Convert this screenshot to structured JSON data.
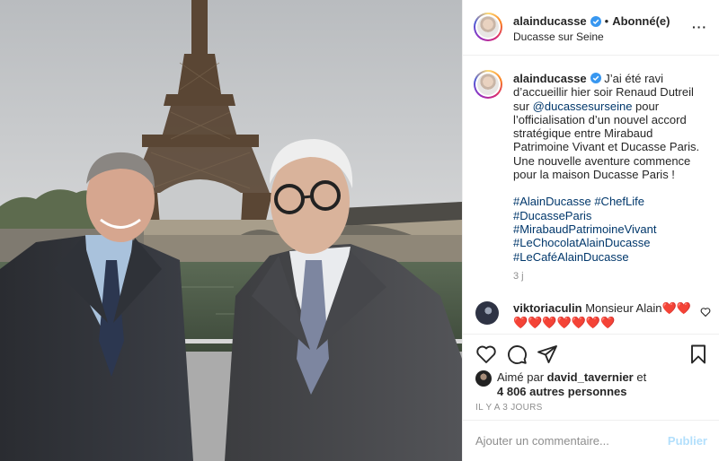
{
  "post": {
    "username": "alainducasse",
    "follow_separator": "•",
    "follow_status": "Abonné(e)",
    "location": "Ducasse sur Seine",
    "more_icon": "more-icon",
    "caption": {
      "username": "alainducasse",
      "text_before_mention": " J’ai été ravi d’accueillir hier soir Renaud Dutreil sur ",
      "mention": "@ducassesurseine",
      "text_after_mention": " pour l’officialisation d’un nouvel accord stratégique entre Mirabaud Patrimoine Vivant et Ducasse Paris. Une nouvelle aventure commence pour la maison Ducasse Paris !",
      "hashtags": [
        "#AlainDucasse #ChefLife",
        "#DucasseParis",
        "#MirabaudPatrimoineVivant",
        "#LeChocolatAlainDucasse",
        "#LeCaféAlainDucasse"
      ],
      "age": "3 j"
    },
    "comment": {
      "username": "viktoriaculin",
      "text": " Monsieur Alain❤️❤️",
      "text_line2": "❤️❤️❤️❤️❤️❤️❤️"
    },
    "likes": {
      "prefix": "Aimé par ",
      "first_user": "david_tavernier",
      "conjunction": " et",
      "others": "4 806 autres personnes"
    },
    "timestamp": "IL Y A 3 JOURS",
    "comment_box": {
      "placeholder": "Ajouter un commentaire...",
      "publish_label": "Publier"
    }
  },
  "colors": {
    "verified_blue": "#3897f0",
    "link_blue": "#00376b",
    "publish_disabled": "#b2dffc",
    "secondary_text": "#8e8e8e"
  }
}
